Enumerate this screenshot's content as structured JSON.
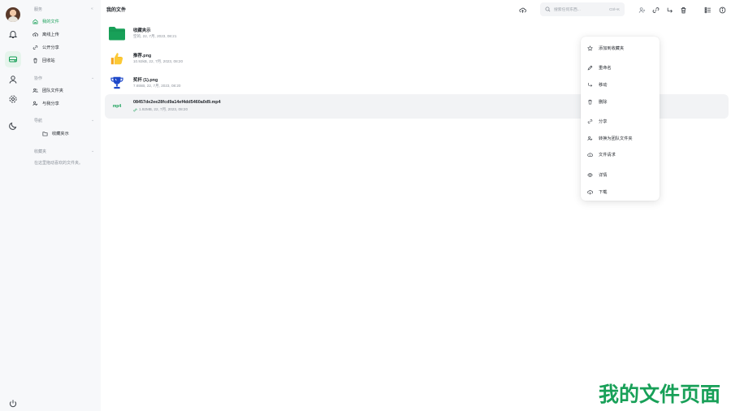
{
  "colors": {
    "accent": "#18a058",
    "folder": "#18a058",
    "trophy": "#1f49c9",
    "sidebar_bg": "#f7f8fa",
    "selected_row": "#f2f3f5"
  },
  "rail": {
    "icons": [
      "avatar",
      "bell-icon",
      "drive-icon",
      "user-icon",
      "settings-icon",
      "moon-icon",
      "power-icon"
    ]
  },
  "sidebar": {
    "section_cloud": "服务",
    "items_cloud": [
      {
        "label": "我的文件",
        "icon": "home-icon",
        "active": true
      },
      {
        "label": "离线上传",
        "icon": "cloud-upload-icon",
        "active": false
      },
      {
        "label": "公开分享",
        "icon": "link-icon",
        "active": false
      },
      {
        "label": "回收站",
        "icon": "trash-icon",
        "active": false
      }
    ],
    "section_collab": "协作",
    "items_collab": [
      {
        "label": "团队文件夹",
        "icon": "team-icon"
      },
      {
        "label": "与我分享",
        "icon": "shared-user-icon"
      }
    ],
    "section_nav": "导航",
    "nav_folder": "收藏夹示",
    "section_fav": "收藏夹",
    "fav_empty": "在这里拖动喜欢的文件夹。"
  },
  "header": {
    "title": "我的文件",
    "search_placeholder": "搜索任何东西...",
    "search_shortcut": "Ctrl+K"
  },
  "files": [
    {
      "name": "收藏夹示",
      "meta": "空的, 22, 7月, 2023, 08:21",
      "type": "folder"
    },
    {
      "name": "推荐.png",
      "meta": "10.92kB, 22, 7月, 2023, 08:20",
      "type": "thumbs-up"
    },
    {
      "name": "奖杯 (1).png",
      "meta": "7.65kB, 22, 7月, 2023, 08:20",
      "type": "trophy"
    },
    {
      "name": "08457de2ee28fcd9a14ef4dd5460a0d9.mp4",
      "meta": "1.92MB, 22, 7月, 2023, 08:20",
      "type": "mp4",
      "thumb_label": "mp4",
      "shared": true,
      "selected": true
    }
  ],
  "context_menu": [
    {
      "label": "添加到收藏夹",
      "icon": "star-icon"
    },
    {
      "label": "重命名",
      "icon": "pencil-icon"
    },
    {
      "label": "移动",
      "icon": "move-icon"
    },
    {
      "label": "删除",
      "icon": "trash-icon"
    },
    {
      "label": "分享",
      "icon": "link-icon"
    },
    {
      "label": "转换为团队文件夹",
      "icon": "team-convert-icon"
    },
    {
      "label": "文件请求",
      "icon": "cloud-request-icon"
    },
    {
      "label": "详情",
      "icon": "eye-icon"
    },
    {
      "label": "下载",
      "icon": "download-icon"
    }
  ],
  "watermark": "我的文件页面"
}
